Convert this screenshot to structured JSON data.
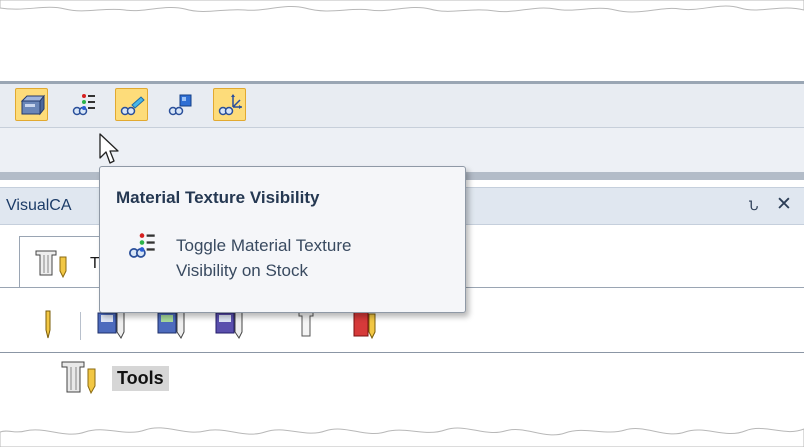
{
  "toolbar": {
    "buttons": [
      {
        "icon": "stock-box-icon",
        "state": "active"
      },
      {
        "icon": "material-texture-visibility-icon",
        "state": "hover"
      },
      {
        "icon": "toolpath-visibility-icon",
        "state": "active"
      },
      {
        "icon": "fixture-visibility-icon",
        "state": "normal"
      },
      {
        "icon": "axis-visibility-icon",
        "state": "active"
      }
    ]
  },
  "tooltip": {
    "title": "Material Texture Visibility",
    "description": "Toggle Material Texture Visibility on Stock",
    "description_line1": "Toggle Material Texture",
    "description_line2": "Visibility on Stock"
  },
  "panel": {
    "title": "VisualCA",
    "pin_glyph": "Ն",
    "close_glyph": "✕",
    "tab": {
      "label": "T"
    }
  },
  "subtoolbar": {
    "icons": [
      "tool-icon",
      "save-tool-icon",
      "save-tool-green-icon",
      "save-tool-purple-icon",
      "tool-holder-icon",
      "red-tool-icon"
    ]
  },
  "tree": {
    "items": [
      {
        "label": "Tools",
        "icon": "tools-folder-icon"
      }
    ]
  },
  "colors": {
    "active_button_bg": "#fddc7a",
    "active_button_border": "#e2a930",
    "panel_header_bg": "#e0e7f0",
    "panel_title": "#1c3c68",
    "tooltip_bg": "#f5f6f9",
    "tooltip_title": "#253852"
  }
}
